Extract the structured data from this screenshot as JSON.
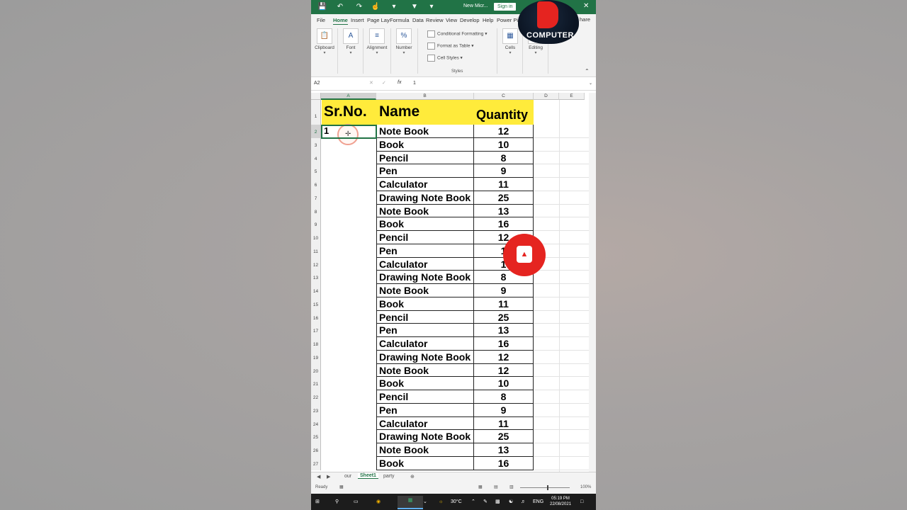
{
  "titlebar": {
    "doc_title": "New Micr...",
    "signin": "Sign in"
  },
  "menu": [
    "File",
    "Home",
    "Insert",
    "Page Lay",
    "Formula",
    "Data",
    "Review",
    "View",
    "Develop",
    "Help",
    "Power Pi"
  ],
  "share": "hare",
  "ribbon": {
    "clipboard": "Clipboard",
    "font": "Font",
    "alignment": "Alignment",
    "number": "Number",
    "conditional": "Conditional Formatting",
    "format_table": "Format as Table",
    "cell_styles": "Cell Styles",
    "styles": "Styles",
    "cells": "Cells",
    "editing": "Editing"
  },
  "formula": {
    "namebox": "A2",
    "fx": "fx",
    "value": "1"
  },
  "columns": [
    "A",
    "B",
    "C",
    "D",
    "E"
  ],
  "headers": {
    "sr": "Sr.No.",
    "name": "Name",
    "qty": "Quantity"
  },
  "rows": [
    {
      "r": "2",
      "sr": "1",
      "name": "Note Book",
      "qty": "12"
    },
    {
      "r": "3",
      "sr": "",
      "name": "Book",
      "qty": "10"
    },
    {
      "r": "4",
      "sr": "",
      "name": "Pencil",
      "qty": "8"
    },
    {
      "r": "5",
      "sr": "",
      "name": "Pen",
      "qty": "9"
    },
    {
      "r": "6",
      "sr": "",
      "name": "Calculator",
      "qty": "11"
    },
    {
      "r": "7",
      "sr": "",
      "name": "Drawing Note Book",
      "qty": "25"
    },
    {
      "r": "8",
      "sr": "",
      "name": "Note Book",
      "qty": "13"
    },
    {
      "r": "9",
      "sr": "",
      "name": "Book",
      "qty": "16"
    },
    {
      "r": "10",
      "sr": "",
      "name": "Pencil",
      "qty": "12"
    },
    {
      "r": "11",
      "sr": "",
      "name": "Pen",
      "qty": "1"
    },
    {
      "r": "12",
      "sr": "",
      "name": "Calculator",
      "qty": "1"
    },
    {
      "r": "13",
      "sr": "",
      "name": "Drawing Note Book",
      "qty": "8"
    },
    {
      "r": "14",
      "sr": "",
      "name": "Note Book",
      "qty": "9"
    },
    {
      "r": "15",
      "sr": "",
      "name": "Book",
      "qty": "11"
    },
    {
      "r": "16",
      "sr": "",
      "name": "Pencil",
      "qty": "25"
    },
    {
      "r": "17",
      "sr": "",
      "name": "Pen",
      "qty": "13"
    },
    {
      "r": "18",
      "sr": "",
      "name": "Calculator",
      "qty": "16"
    },
    {
      "r": "19",
      "sr": "",
      "name": "Drawing Note Book",
      "qty": "12"
    },
    {
      "r": "20",
      "sr": "",
      "name": "Note Book",
      "qty": "12"
    },
    {
      "r": "21",
      "sr": "",
      "name": "Book",
      "qty": "10"
    },
    {
      "r": "22",
      "sr": "",
      "name": "Pencil",
      "qty": "8"
    },
    {
      "r": "23",
      "sr": "",
      "name": "Pen",
      "qty": "9"
    },
    {
      "r": "24",
      "sr": "",
      "name": "Calculator",
      "qty": "11"
    },
    {
      "r": "25",
      "sr": "",
      "name": "Drawing Note Book",
      "qty": "25"
    },
    {
      "r": "26",
      "sr": "",
      "name": "Note Book",
      "qty": "13"
    },
    {
      "r": "27",
      "sr": "",
      "name": "Book",
      "qty": "16"
    }
  ],
  "sheets": {
    "prev": "our",
    "active": "Sheet1",
    "next": "party"
  },
  "status": {
    "ready": "Ready",
    "zoom": "100%"
  },
  "taskbar": {
    "temp": "30°C",
    "lang": "ENG",
    "time": "05:19 PM",
    "date": "22/08/2021"
  },
  "logo": "COMPUTER",
  "colors": {
    "excel_green": "#217346",
    "header_yellow": "#ffeb3b",
    "brand_red": "#e52420"
  }
}
